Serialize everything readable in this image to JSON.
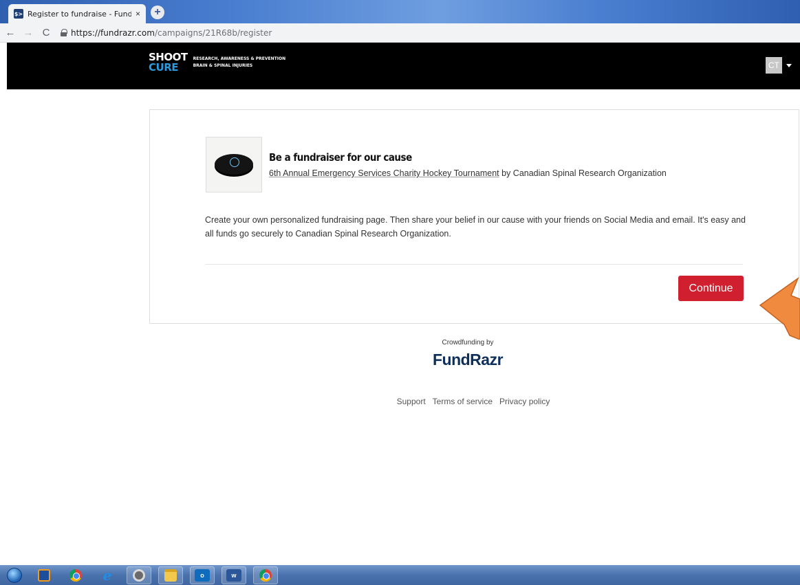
{
  "browser": {
    "tab_title": "Register to fundraise - FundRazr",
    "tab_close": "×",
    "tab_favicon_text": "$>",
    "new_tab": "+",
    "url_host": "https://fundrazr.com",
    "url_path": "/campaigns/21R68b/register",
    "back": "←",
    "forward": "→",
    "reload": "C"
  },
  "header": {
    "logo_line1": "SHOOT",
    "logo_line2": "CURE",
    "tag_line1": "RESEARCH, AWARENESS & PREVENTION",
    "tag_line2": "BRAIN & SPINAL INJURIES",
    "avatar_initials": "CT"
  },
  "card": {
    "title": "Be a fundraiser for our cause",
    "campaign_link": "6th Annual Emergency Services Charity Hockey Tournament",
    "by_text": " by Canadian Spinal Research Organization",
    "description": "Create your own personalized fundraising page. Then share your belief in our cause with your friends on Social Media and email. It's easy and all funds go securely to Canadian Spinal Research Organization.",
    "continue_label": "Continue"
  },
  "footer": {
    "powered_by": "Crowdfunding by",
    "brand": "FundRazr",
    "links": [
      "Support",
      "Terms of service",
      "Privacy policy"
    ]
  },
  "colors": {
    "accent": "#d0202f",
    "header_bg": "#000000",
    "brand_navy": "#0e2f5a",
    "arrow": "#f08a3e"
  },
  "taskbar": {
    "items": [
      "start-icon",
      "media-player-icon",
      "chrome-icon",
      "internet-explorer-icon",
      "ccleaner-icon",
      "file-explorer-icon",
      "outlook-icon",
      "word-icon",
      "chrome-icon"
    ]
  }
}
